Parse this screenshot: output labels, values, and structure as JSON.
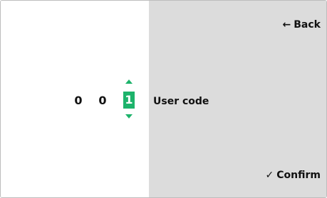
{
  "code": {
    "digits": [
      "0",
      "0",
      "1"
    ],
    "active_index": 2,
    "label": "User code"
  },
  "nav": {
    "back_icon": "←",
    "back_label": "Back",
    "confirm_icon": "✓",
    "confirm_label": "Confirm"
  },
  "colors": {
    "accent": "#1db36b",
    "panel_bg": "#dcdcdc"
  }
}
